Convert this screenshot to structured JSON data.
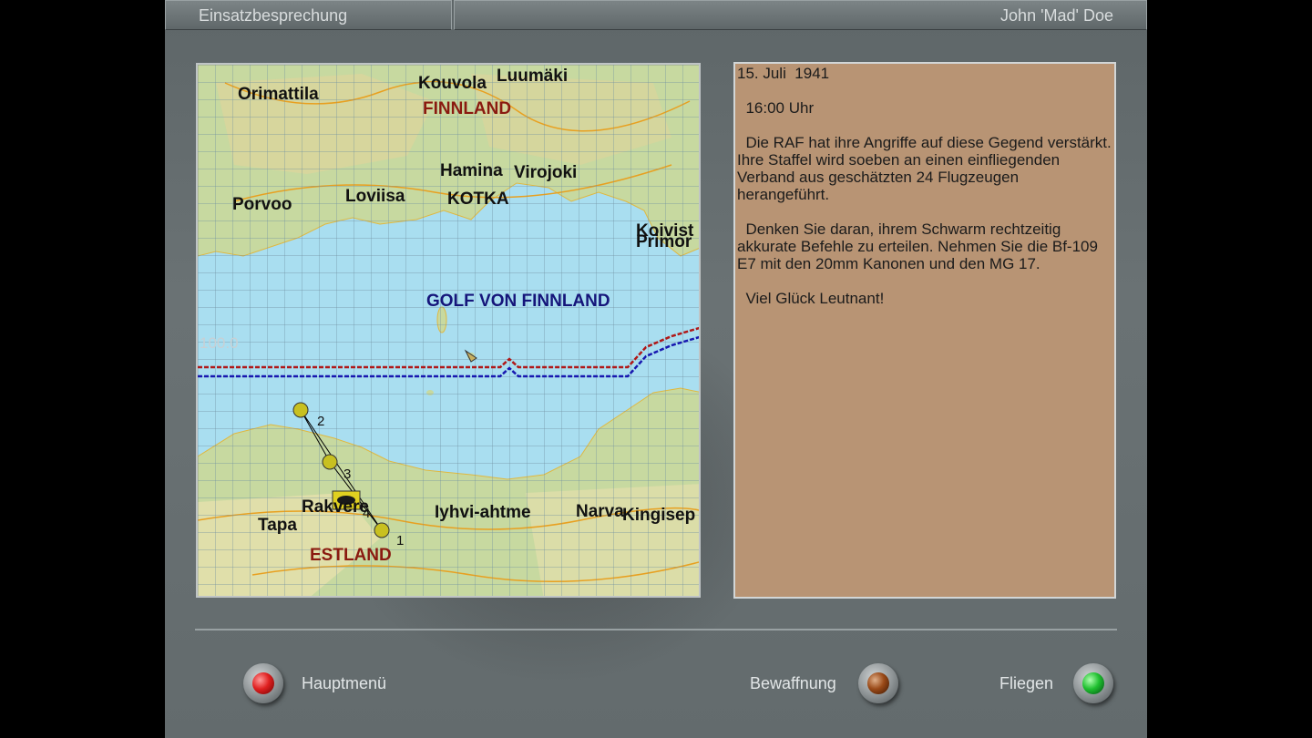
{
  "header": {
    "title": "Einsatzbesprechung",
    "pilot": "John 'Mad' Doe"
  },
  "map": {
    "places": {
      "orimattila": "Orimattila",
      "kouvola": "Kouvola",
      "luumaki": "Luumäki",
      "finnland": "FINNLAND",
      "hamina": "Hamina",
      "virojoki": "Virojoki",
      "porvoo": "Porvoo",
      "loviisa": "Loviisa",
      "kotka": "KOTKA",
      "koivisto": "Koivist",
      "primorsk": "Primor",
      "golf": "GOLF VON FINNLAND",
      "tapa": "Tapa",
      "rakvere": "Rakvere",
      "jyhvi": "Iyhvi-ahtme",
      "narva": "Narva",
      "kingisepp": "Kingisep",
      "estland": "ESTLAND"
    },
    "altitude_label": "100.0",
    "waypoints": [
      "1",
      "2",
      "3",
      "4"
    ]
  },
  "briefing": {
    "date": "15. Juli  1941",
    "time": "  16:00 Uhr",
    "paragraph1": "  Die RAF hat ihre Angriffe auf diese Gegend verstärkt. Ihre Staffel wird soeben an einen einfliegenden Verband aus geschätzten 24 Flugzeugen herangeführt.",
    "paragraph2": "  Denken Sie daran, ihrem Schwarm rechtzeitig akkurate Befehle zu erteilen. Nehmen Sie die Bf-109 E7 mit den 20mm Kanonen und den MG 17.",
    "closing": "  Viel Glück Leutnant!"
  },
  "buttons": {
    "main_menu": "Hauptmenü",
    "armament": "Bewaffnung",
    "fly": "Fliegen"
  },
  "colors": {
    "briefing_bg": "#b89474",
    "frame": "#6a7274",
    "route_red": "#b01818",
    "route_blue": "#1818b0"
  }
}
